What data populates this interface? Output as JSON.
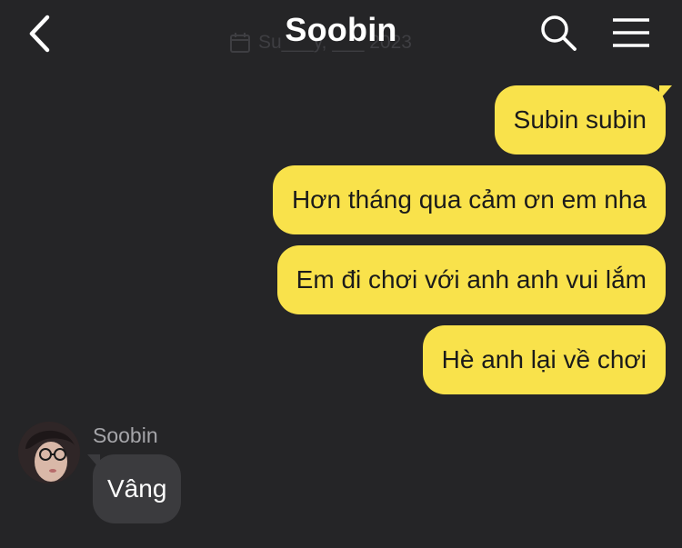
{
  "header": {
    "title": "Soobin",
    "date_text": "Su___y, ___ 2023"
  },
  "messages_out": [
    {
      "text": "Subin subin"
    },
    {
      "text": "Hơn tháng qua cảm ơn em nha"
    },
    {
      "text": "Em đi chơi với anh anh vui lắm"
    },
    {
      "text": "Hè anh lại về chơi"
    }
  ],
  "incoming": {
    "sender": "Soobin",
    "text": "Vâng"
  },
  "colors": {
    "background": "#252527",
    "outgoing_bubble": "#f9e24b",
    "incoming_bubble": "#3b3b3e",
    "accent_text": "#ffffff"
  },
  "icons": [
    "back-arrow-icon",
    "calendar-icon",
    "search-icon",
    "menu-icon"
  ]
}
